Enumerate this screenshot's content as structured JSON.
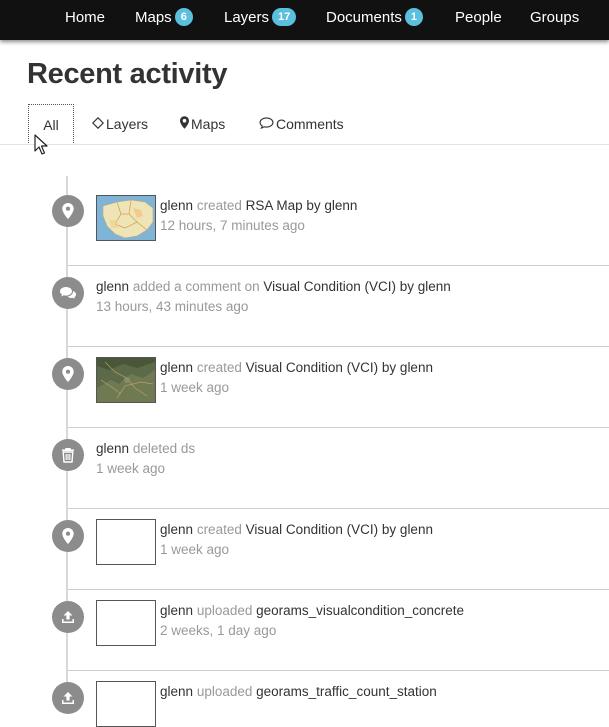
{
  "nav": {
    "items": [
      {
        "label": "Home",
        "badge": ""
      },
      {
        "label": "Maps",
        "badge": "6"
      },
      {
        "label": "Layers",
        "badge": "17"
      },
      {
        "label": "Documents",
        "badge": "1"
      },
      {
        "label": "People",
        "badge": ""
      },
      {
        "label": "Groups",
        "badge": ""
      }
    ]
  },
  "page_title": "Recent activity",
  "tabs": [
    {
      "label": "All",
      "icon": "none",
      "active": true
    },
    {
      "label": "Layers",
      "icon": "diamond-icon"
    },
    {
      "label": "Maps",
      "icon": "map-marker-icon"
    },
    {
      "label": "Comments",
      "icon": "comment-icon"
    }
  ],
  "activity": [
    {
      "icon": "map-marker-icon",
      "thumbnail": "map-thumbnail",
      "user": "glenn",
      "verb": "created",
      "object": "RSA Map by glenn",
      "time": "12 hours, 7 minutes ago"
    },
    {
      "icon": "comment-icon",
      "thumbnail": "none",
      "user": "glenn",
      "verb": "added a comment on",
      "object": "Visual Condition (VCI) by glenn",
      "time": "13 hours, 43 minutes ago"
    },
    {
      "icon": "map-marker-icon",
      "thumbnail": "map-thumbnail",
      "user": "glenn",
      "verb": "created",
      "object": "Visual Condition (VCI) by glenn",
      "time": "1 week ago"
    },
    {
      "icon": "trash-icon",
      "thumbnail": "none",
      "user": "glenn",
      "verb": "deleted",
      "object": "ds",
      "time": "1 week ago"
    },
    {
      "icon": "map-marker-icon",
      "thumbnail": "blank",
      "user": "glenn",
      "verb": "created",
      "object": "Visual Condition (VCI) by glenn",
      "time": "1 week ago"
    },
    {
      "icon": "upload-icon",
      "thumbnail": "blank",
      "user": "glenn",
      "verb": "uploaded",
      "object": "georams_visualcondition_concrete",
      "time": "2 weeks, 1 day ago"
    },
    {
      "icon": "upload-icon",
      "thumbnail": "blank",
      "user": "glenn",
      "verb": "uploaded",
      "object": "georams_traffic_count_station",
      "time": ""
    }
  ]
}
